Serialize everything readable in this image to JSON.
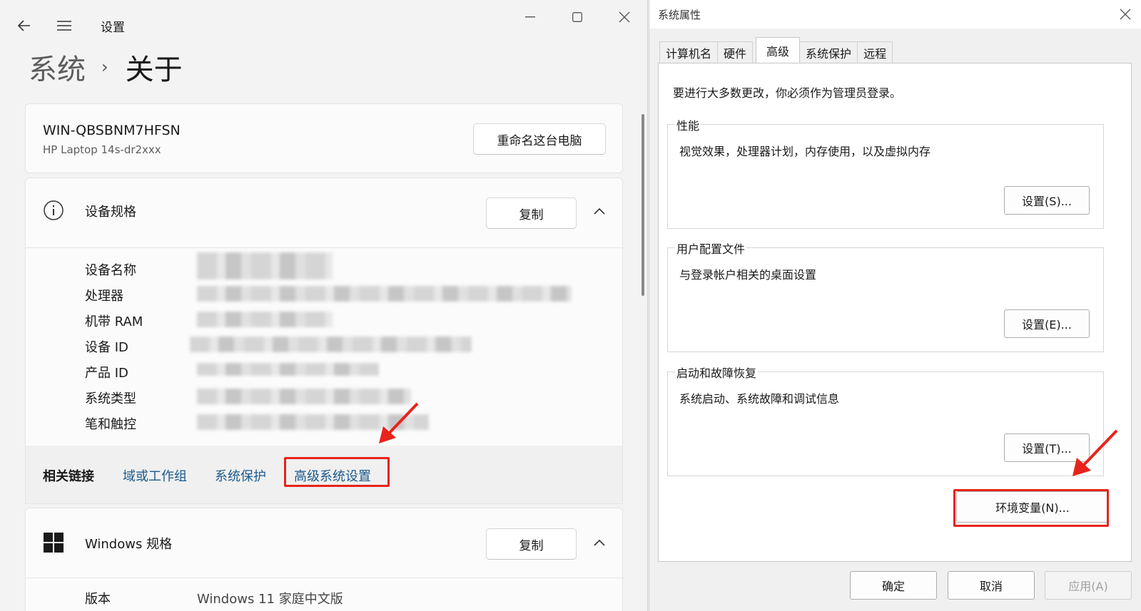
{
  "settings": {
    "title": "设置",
    "breadcrumb": {
      "parent": "系统",
      "separator": "›",
      "current": "关于"
    },
    "device_card": {
      "computer_name": "WIN-QBSBNM7HFSN",
      "model": "HP Laptop 14s-dr2xxx",
      "rename_button": "重命名这台电脑"
    },
    "device_specs": {
      "heading": "设备规格",
      "copy_button": "复制",
      "rows": [
        "设备名称",
        "处理器",
        "机带 RAM",
        "设备 ID",
        "产品 ID",
        "系统类型",
        "笔和触控"
      ]
    },
    "related_links": {
      "title": "相关链接",
      "links": [
        "域或工作组",
        "系统保护",
        "高级系统设置"
      ]
    },
    "windows_specs": {
      "heading": "Windows 规格",
      "copy_button": "复制",
      "edition_label": "版本",
      "edition_value": "Windows 11 家庭中文版"
    }
  },
  "dialog": {
    "title": "系统属性",
    "tabs": [
      "计算机名",
      "硬件",
      "高级",
      "系统保护",
      "远程"
    ],
    "active_tab": "高级",
    "admin_note": "要进行大多数更改，你必须作为管理员登录。",
    "groups": [
      {
        "legend": "性能",
        "description": "视觉效果，处理器计划，内存使用，以及虚拟内存",
        "button": "设置(S)..."
      },
      {
        "legend": "用户配置文件",
        "description": "与登录帐户相关的桌面设置",
        "button": "设置(E)..."
      },
      {
        "legend": "启动和故障恢复",
        "description": "系统启动、系统故障和调试信息",
        "button": "设置(T)..."
      }
    ],
    "env_button": "环境变量(N)...",
    "footer": {
      "ok": "确定",
      "cancel": "取消",
      "apply": "应用(A)"
    }
  },
  "colors": {
    "highlight": "#e8231c",
    "link": "#1b5a8c"
  }
}
